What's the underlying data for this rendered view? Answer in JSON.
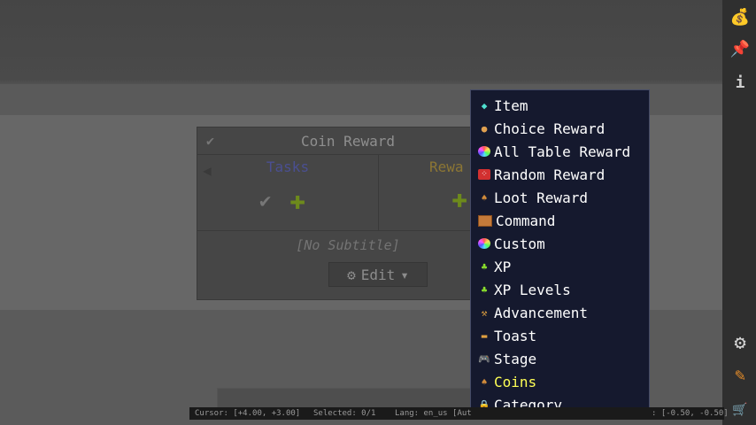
{
  "panel": {
    "title": "Coin Reward",
    "tasks_label": "Tasks",
    "rewards_label": "Rewa",
    "subtitle": "[No Subtitle]",
    "edit_label": "Edit"
  },
  "menu": {
    "items": [
      {
        "label": "Item",
        "icon": "diamond-icon"
      },
      {
        "label": "Choice Reward",
        "icon": "palette-icon"
      },
      {
        "label": "All Table Reward",
        "icon": "rainbow-icon"
      },
      {
        "label": "Random Reward",
        "icon": "dice-icon"
      },
      {
        "label": "Loot Reward",
        "icon": "money-bag-icon"
      },
      {
        "label": "Command",
        "icon": "command-block-icon"
      },
      {
        "label": "Custom",
        "icon": "rainbow-icon"
      },
      {
        "label": "XP",
        "icon": "xp-bottle-icon"
      },
      {
        "label": "XP Levels",
        "icon": "xp-bottle-icon"
      },
      {
        "label": "Advancement",
        "icon": "advancement-icon"
      },
      {
        "label": "Toast",
        "icon": "sign-icon"
      },
      {
        "label": "Stage",
        "icon": "gamepad-icon"
      },
      {
        "label": "Coins",
        "icon": "money-bag-icon",
        "active": true
      },
      {
        "label": "Category",
        "icon": "lock-icon"
      }
    ],
    "active_color": "#ffff55"
  },
  "status": {
    "cursor": "Cursor: [+4.00, +3.00]",
    "selected": "Selected: 0/1",
    "lang": "Lang: en_us [Aut",
    "coords": ": [-0.50, -0.50]"
  },
  "sidebar": {
    "icons": [
      "money-bag-icon",
      "pin-icon",
      "info-icon",
      "gear-icon",
      "pencil-icon",
      "cart-icon"
    ]
  },
  "colors": {
    "tasks": "#4a4f91",
    "rewards": "#8c7634",
    "plus": "#6d8a1c",
    "menu_bg": "#15192e"
  }
}
